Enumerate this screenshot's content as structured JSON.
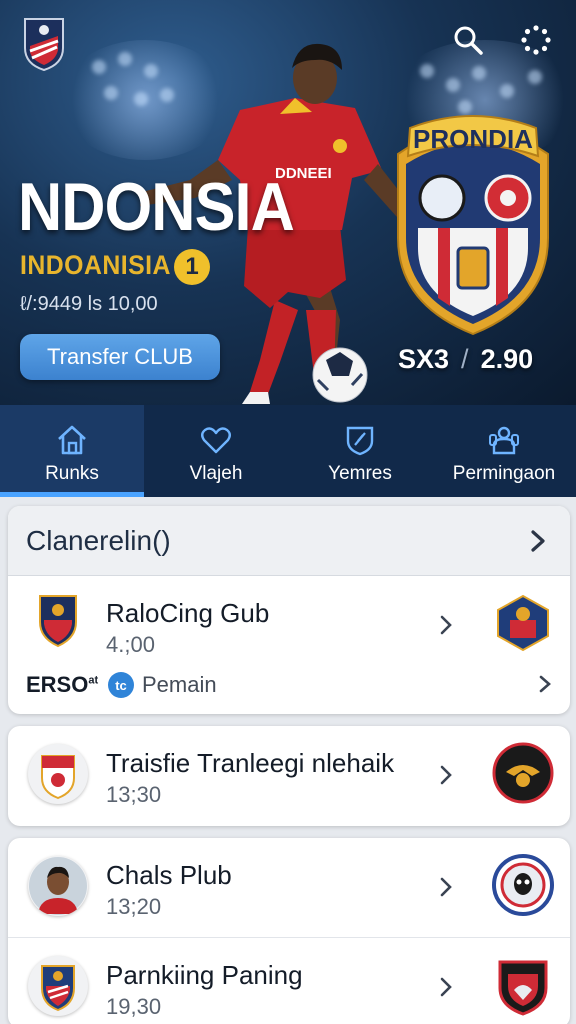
{
  "hero": {
    "title": "NDONSIA",
    "subtitle": "INDOANISIA",
    "rank": "1",
    "meta": "ℓ/:9449 ls 10,00",
    "transfer_label": "Transfer CLUB",
    "crest_text": "PRONDIA",
    "jersey_text": "DDNEEI",
    "score_left": "SX3",
    "score_sep": "/",
    "score_right": "2.90",
    "accent": "#e8b52d"
  },
  "nav": {
    "items": [
      {
        "label": "Runks",
        "icon": "home-icon"
      },
      {
        "label": "Vlajeh",
        "icon": "heart-icon"
      },
      {
        "label": "Yemres",
        "icon": "shield-icon"
      },
      {
        "label": "Permingaon",
        "icon": "people-icon"
      }
    ],
    "active_color": "#4aa3ff"
  },
  "list": {
    "header": "Clanerelin()",
    "rows": [
      {
        "title": "RaloCing Gub",
        "time": "4.;00"
      },
      {
        "title": "Traisfie Tranleegi nlehaik",
        "time": "13;30"
      },
      {
        "title": "Chals Plub",
        "time": "13;20"
      },
      {
        "title": "Parnkiing Paning",
        "time": "19,30"
      }
    ],
    "sub": {
      "tag": "ERSO",
      "tag_sup": "at",
      "pill": "tc",
      "text": "Pemain"
    }
  }
}
